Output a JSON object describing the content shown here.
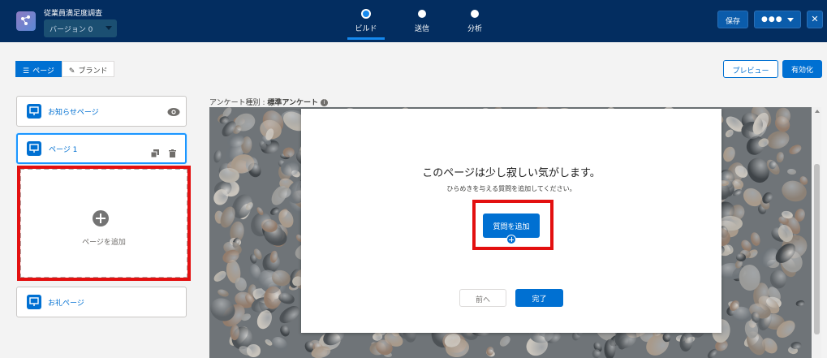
{
  "header": {
    "app_title": "従業員満足度調査",
    "version": "バージョン 0",
    "steps": [
      {
        "label": "ビルド",
        "active": true
      },
      {
        "label": "送信",
        "active": false
      },
      {
        "label": "分析",
        "active": false
      }
    ],
    "save_label": "保存",
    "more_label": "●●●",
    "close_label": "✕"
  },
  "toolbar": {
    "page_tab": "ページ",
    "brand_tab": "ブランド",
    "preview_label": "プレビュー",
    "activate_label": "有効化"
  },
  "pages": {
    "welcome": "お知らせページ",
    "page1": "ページ 1",
    "add_page": "ページを追加",
    "thank_you": "お礼ページ"
  },
  "survey_type": {
    "label": "アンケート種別 : ",
    "value": "標準アンケート"
  },
  "dialog": {
    "title": "このページは少し寂しい気がします。",
    "subtitle": "ひらめきを与える質問を追加してください。",
    "add_question": "質問を追加",
    "prev_label": "前へ",
    "done_label": "完了"
  },
  "colors": {
    "header_bg": "#032d60",
    "brand_blue": "#0070d2",
    "highlight_red": "#e31010"
  }
}
